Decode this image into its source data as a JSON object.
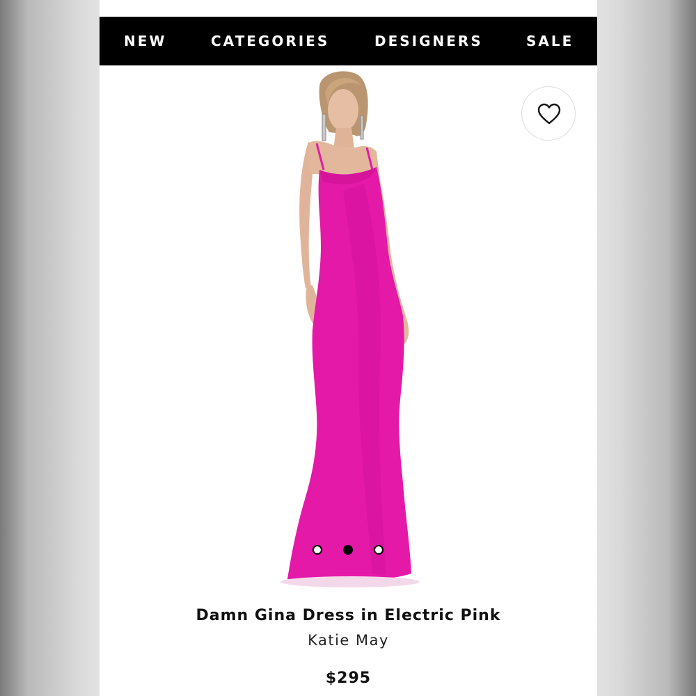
{
  "nav": {
    "items": [
      {
        "label": "NEW"
      },
      {
        "label": "CATEGORIES"
      },
      {
        "label": "DESIGNERS"
      },
      {
        "label": "SALE"
      }
    ]
  },
  "product": {
    "name": "Damn Gina Dress in Electric Pink",
    "brand": "Katie May",
    "price": "$295",
    "image_description": "Model wearing a floor-length fitted magenta slip gown",
    "dress_color": "#e419a8"
  },
  "carousel": {
    "total": 3,
    "active_index": 1
  },
  "icons": {
    "wishlist": "heart-icon"
  }
}
